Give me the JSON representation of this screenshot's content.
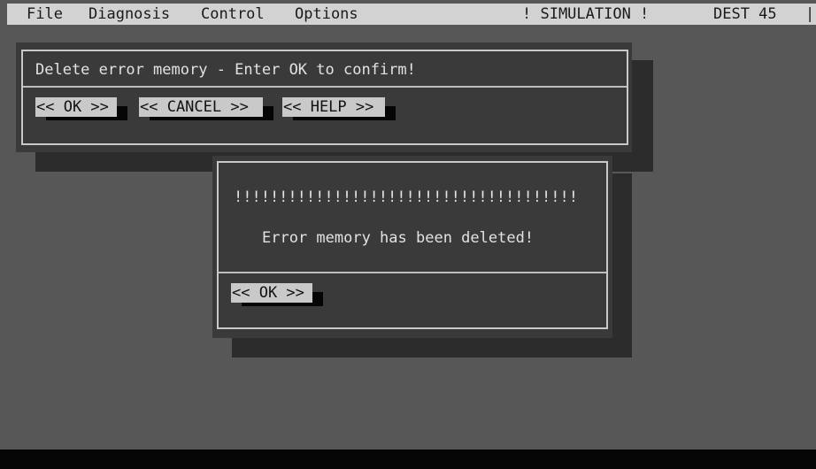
{
  "menubar": {
    "items": [
      "File",
      "Diagnosis",
      "Control",
      "Options"
    ],
    "mode_label": "! SIMULATION !",
    "dest_label": "DEST 45",
    "edge_glyph": "|"
  },
  "confirm_dialog": {
    "message": "Delete error memory - Enter OK to confirm!",
    "buttons": {
      "ok": "<< OK >>",
      "cancel": "<< CANCEL >>",
      "help": "<< HELP >>"
    }
  },
  "info_dialog": {
    "banner": "!!!!!!!!!!!!!!!!!!!!!!!!!!!!!!!!!!!!!!",
    "message": "Error memory has been deleted!",
    "buttons": {
      "ok": "<< OK >>"
    }
  },
  "colors": {
    "background": "#575757",
    "menubar": "#d2d2d2",
    "dialog": "#3a3a3a",
    "button_face": "#c9c9c9",
    "text": "#e2e2e2"
  }
}
